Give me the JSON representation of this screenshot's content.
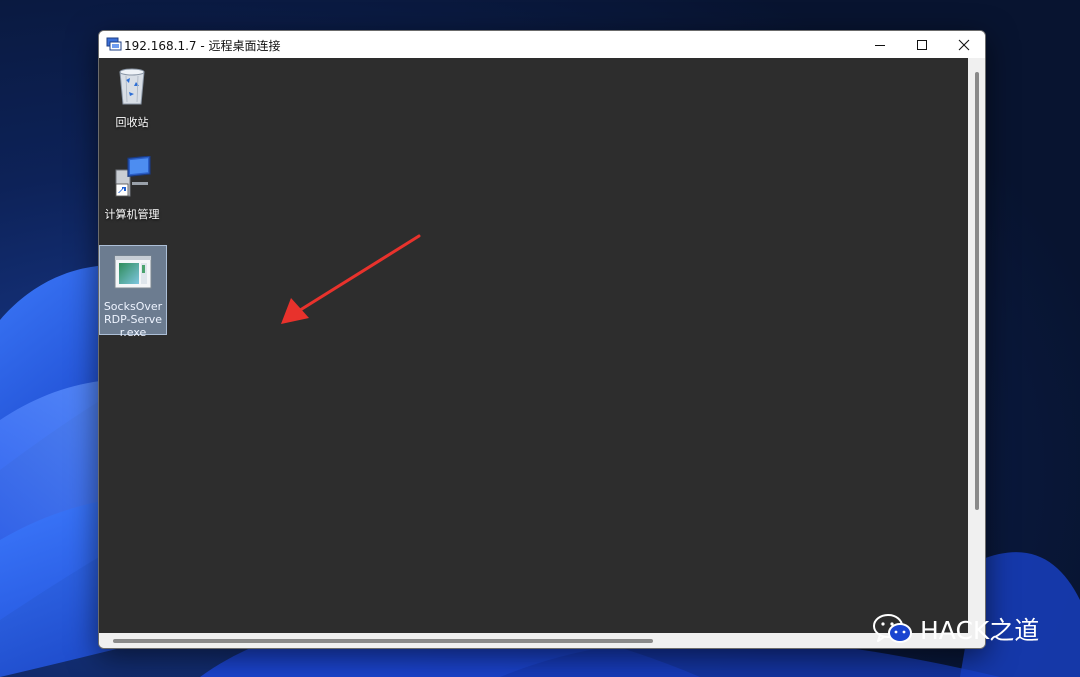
{
  "window": {
    "title": "192.168.1.7 - 远程桌面连接",
    "controls": {
      "minimize_icon": "minimize-icon",
      "maximize_icon": "maximize-icon",
      "close_icon": "close-icon"
    }
  },
  "desktop": {
    "background_color": "#2d2d2d",
    "icons": [
      {
        "label": "回收站",
        "icon": "recycle-bin-icon",
        "selected": false
      },
      {
        "label": "计算机管理",
        "icon": "computer-management-icon",
        "selected": false
      },
      {
        "label": "SocksOverRDP-Server.exe",
        "icon": "exe-app-icon",
        "selected": true
      }
    ]
  },
  "annotation": {
    "icon": "red-arrow-icon",
    "color": "#e8322c"
  },
  "watermark": {
    "icon": "wechat-icon",
    "text": "HACK之道"
  },
  "colors": {
    "wallpaper_base": "#0a1a3a",
    "wallpaper_accent": "#1f5cff",
    "selection": "#a0bee1"
  }
}
